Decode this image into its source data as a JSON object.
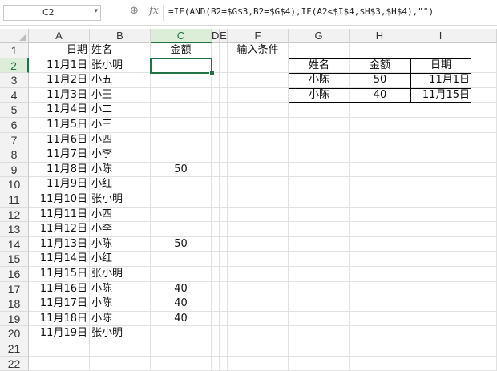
{
  "namebox": {
    "value": "C2",
    "arrow": "▾"
  },
  "formula_bar": {
    "zoom_icon": "⊕",
    "cancel_icon": "✕",
    "fx_label": "fx",
    "formula": "=IF(AND(B2=$G$3,B2=$G$4),IF(A2<$I$4,$H$3,$H$4),\"\")"
  },
  "columns": [
    "A",
    "B",
    "C",
    "D",
    "E",
    "F",
    "G",
    "H",
    "I"
  ],
  "selected_column": "C",
  "selected_row": "2",
  "rows": [
    "1",
    "2",
    "3",
    "4",
    "5",
    "6",
    "7",
    "8",
    "9",
    "10",
    "11",
    "12",
    "13",
    "14",
    "15",
    "16",
    "17",
    "18",
    "19",
    "20",
    "21",
    "22"
  ],
  "sheet": {
    "A": [
      "日期",
      "11月1日",
      "11月2日",
      "11月3日",
      "11月4日",
      "11月5日",
      "11月6日",
      "11月7日",
      "11月8日",
      "11月9日",
      "11月10日",
      "11月11日",
      "11月12日",
      "11月13日",
      "11月14日",
      "11月15日",
      "11月16日",
      "11月17日",
      "11月18日",
      "11月19日",
      "",
      ""
    ],
    "B": [
      "姓名",
      "张小明",
      "小五",
      "小王",
      "小二",
      "小三",
      "小四",
      "小李",
      "小陈",
      "小红",
      "张小明",
      "小四",
      "小李",
      "小陈",
      "小红",
      "张小明",
      "小陈",
      "小陈",
      "小陈",
      "张小明",
      "",
      ""
    ],
    "C": [
      "金额",
      "",
      "",
      "",
      "",
      "",
      "",
      "",
      "50",
      "",
      "",
      "",
      "",
      "50",
      "",
      "",
      "40",
      "40",
      "40",
      "",
      "",
      ""
    ],
    "F": [
      "输入条件"
    ]
  },
  "lookup_table": {
    "headers": [
      "姓名",
      "金额",
      "日期"
    ],
    "rows": [
      [
        "小陈",
        "50",
        "11月1日"
      ],
      [
        "小陈",
        "40",
        "11月15日"
      ]
    ]
  },
  "colors": {
    "accent": "#217346"
  }
}
